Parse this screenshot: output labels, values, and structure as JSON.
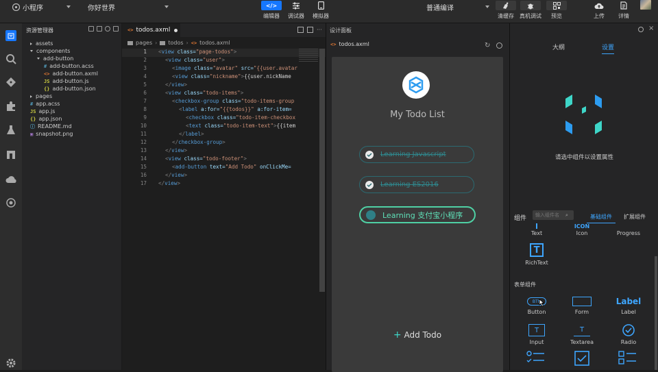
{
  "topbar": {
    "app_name": "小程序",
    "project": "你好世界",
    "compile_mode": "普通编译",
    "buttons": {
      "editor": "编辑器",
      "debugger": "调试器",
      "simulator": "模拟器",
      "clear_cache": "清缓存",
      "device_debug": "真机调试",
      "preview": "预览",
      "upload": "上传",
      "details": "详情"
    }
  },
  "explorer": {
    "title": "资源管理器",
    "tree": [
      "assets",
      "components",
      "add-button",
      "add-button.acss",
      "add-button.axml",
      "add-button.js",
      "add-button.json",
      "pages",
      "app.acss",
      "app.js",
      "app.json",
      "README.md",
      "snapshot.png"
    ],
    "icons": {
      "acss": "#",
      "axml": "<>",
      "js": "JS",
      "json": "{}",
      "md": "ⓘ",
      "png": "▣"
    }
  },
  "editor": {
    "tab": "todos.axml",
    "breadcrumb": [
      "pages",
      "todos",
      "todos.axml"
    ],
    "lines": [
      {
        "n": "1",
        "indent": 0,
        "parts": [
          [
            "p",
            "<"
          ],
          [
            "t",
            "view"
          ],
          [
            "a",
            " class="
          ],
          [
            "s",
            "\"page-todos\""
          ],
          [
            "p",
            ">"
          ]
        ]
      },
      {
        "n": "2",
        "indent": 1,
        "parts": [
          [
            "p",
            "<"
          ],
          [
            "t",
            "view"
          ],
          [
            "a",
            " class="
          ],
          [
            "s",
            "\"user\""
          ],
          [
            "p",
            ">"
          ]
        ]
      },
      {
        "n": "3",
        "indent": 2,
        "parts": [
          [
            "p",
            "<"
          ],
          [
            "t",
            "image"
          ],
          [
            "a",
            " class="
          ],
          [
            "s",
            "\"avatar\""
          ],
          [
            "a",
            " src="
          ],
          [
            "s",
            "\"{{user.avatar"
          ]
        ]
      },
      {
        "n": "4",
        "indent": 2,
        "parts": [
          [
            "p",
            "<"
          ],
          [
            "t",
            "view"
          ],
          [
            "a",
            " class="
          ],
          [
            "s",
            "\"nickname\""
          ],
          [
            "p",
            ">"
          ],
          [
            "x",
            "{{user.nickName"
          ]
        ]
      },
      {
        "n": "5",
        "indent": 1,
        "parts": [
          [
            "p",
            "</"
          ],
          [
            "t",
            "view"
          ],
          [
            "p",
            ">"
          ]
        ]
      },
      {
        "n": "6",
        "indent": 1,
        "parts": [
          [
            "p",
            "<"
          ],
          [
            "t",
            "view"
          ],
          [
            "a",
            " class="
          ],
          [
            "s",
            "\"todo-items\""
          ],
          [
            "p",
            ">"
          ]
        ]
      },
      {
        "n": "7",
        "indent": 2,
        "parts": [
          [
            "p",
            "<"
          ],
          [
            "t",
            "checkbox-group"
          ],
          [
            "a",
            " class="
          ],
          [
            "s",
            "\"todo-items-group"
          ]
        ]
      },
      {
        "n": "8",
        "indent": 3,
        "parts": [
          [
            "p",
            "<"
          ],
          [
            "t",
            "label"
          ],
          [
            "a",
            " a:for="
          ],
          [
            "s",
            "\"{{todos}}\""
          ],
          [
            "a",
            " a:for-item="
          ]
        ]
      },
      {
        "n": "9",
        "indent": 4,
        "parts": [
          [
            "p",
            "<"
          ],
          [
            "t",
            "checkbox"
          ],
          [
            "a",
            " class="
          ],
          [
            "s",
            "\"todo-item-checkbox"
          ]
        ]
      },
      {
        "n": "10",
        "indent": 4,
        "parts": [
          [
            "p",
            "<"
          ],
          [
            "t",
            "text"
          ],
          [
            "a",
            " class="
          ],
          [
            "s",
            "\"todo-item-text\""
          ],
          [
            "p",
            ">"
          ],
          [
            "x",
            "{{item"
          ]
        ]
      },
      {
        "n": "11",
        "indent": 3,
        "parts": [
          [
            "p",
            "</"
          ],
          [
            "t",
            "label"
          ],
          [
            "p",
            ">"
          ]
        ]
      },
      {
        "n": "12",
        "indent": 2,
        "parts": [
          [
            "p",
            "</"
          ],
          [
            "t",
            "checkbox-group"
          ],
          [
            "p",
            ">"
          ]
        ]
      },
      {
        "n": "13",
        "indent": 1,
        "parts": [
          [
            "p",
            "</"
          ],
          [
            "t",
            "view"
          ],
          [
            "p",
            ">"
          ]
        ]
      },
      {
        "n": "14",
        "indent": 1,
        "parts": [
          [
            "p",
            "<"
          ],
          [
            "t",
            "view"
          ],
          [
            "a",
            " class="
          ],
          [
            "s",
            "\"todo-footer\""
          ],
          [
            "p",
            ">"
          ]
        ]
      },
      {
        "n": "15",
        "indent": 2,
        "parts": [
          [
            "p",
            "<"
          ],
          [
            "t",
            "add-button"
          ],
          [
            "a",
            " text="
          ],
          [
            "s",
            "\"Add Todo\""
          ],
          [
            "a",
            " onClickMe="
          ]
        ]
      },
      {
        "n": "16",
        "indent": 1,
        "parts": [
          [
            "p",
            "</"
          ],
          [
            "t",
            "view"
          ],
          [
            "p",
            ">"
          ]
        ]
      },
      {
        "n": "17",
        "indent": 0,
        "parts": [
          [
            "p",
            "</"
          ],
          [
            "t",
            "view"
          ],
          [
            "p",
            ">"
          ]
        ]
      }
    ]
  },
  "design": {
    "title": "设计面板",
    "tab": "todos.axml",
    "app_title": "My Todo List",
    "todos": [
      {
        "text": "Learning Javascript",
        "done": true
      },
      {
        "text": "Learning ES2016",
        "done": true
      },
      {
        "text": "Learning 支付宝小程序",
        "done": false
      }
    ],
    "add_todo": "Add Todo"
  },
  "rpanel": {
    "tabs": [
      "大纲",
      "设置"
    ],
    "empty_hint": "请选中组件以设置属性",
    "components_label": "组件",
    "search_placeholder": "输入组件名",
    "comp_tabs": [
      "基础组件",
      "扩展组件"
    ],
    "row0": [
      "Text",
      "Icon",
      "Progress"
    ],
    "row1": [
      "RichText"
    ],
    "form_section": "表单组件",
    "form_row1": [
      "Button",
      "Form",
      "Label"
    ],
    "form_row2": [
      "Input",
      "Textarea",
      "Radio"
    ],
    "glyph_icon": "ICON",
    "glyph_label": "Label",
    "glyph_btn": "BTN",
    "glyph_text": "T",
    "glyph_richtext": "T"
  },
  "colors": {
    "accent": "#1677ff",
    "teal": "#3ed6c8",
    "green": "#4fd1a5"
  }
}
